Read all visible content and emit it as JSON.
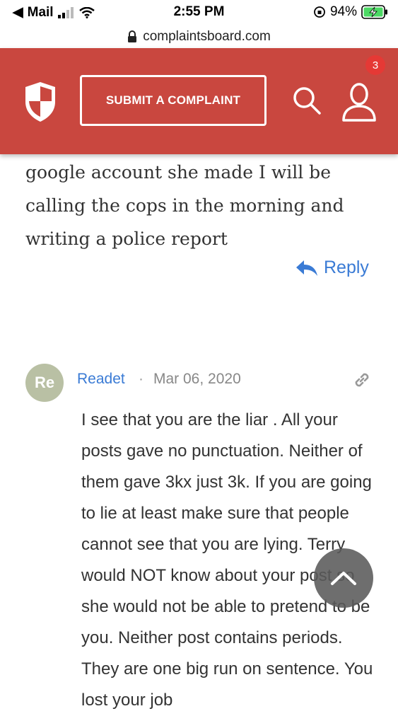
{
  "status_bar": {
    "carrier": "Mail",
    "time": "2:55 PM",
    "battery": "94%"
  },
  "url_bar": {
    "url": "complaintsboard.com"
  },
  "header": {
    "submit_label": "SUBMIT A COMPLAINT",
    "notification_count": "3",
    "brand_color": "#c9473f"
  },
  "previous_comment": {
    "text": "google account she made I will be calling the cops in the morning and writing a police report",
    "reply_label": "Reply"
  },
  "comment": {
    "avatar_initials": "Re",
    "author": "Readet",
    "separator": "·",
    "date": "Mar 06, 2020",
    "text": "I see that you are the liar . All your posts gave no punctuation. Neither of them gave 3kx just 3k. If you are going to lie at least make sure that people cannot see that you are lying. Terry would NOT know about your post so she would not be able to pretend to be you. Neither post contains periods. They are one big run on sentence. You lost your job"
  },
  "icons": {
    "logo": "shield-logo-icon",
    "search": "search-icon",
    "user": "user-icon",
    "reply": "reply-arrow-icon",
    "link": "link-icon",
    "scroll_top": "chevron-up-icon"
  }
}
